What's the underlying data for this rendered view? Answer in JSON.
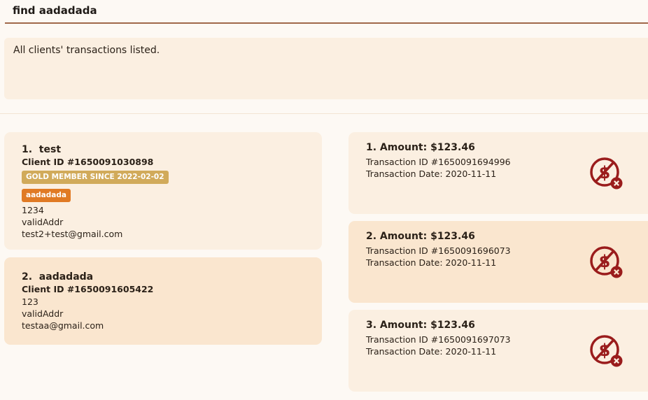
{
  "command": {
    "value": "find aadadada"
  },
  "result": {
    "text": "All clients' transactions listed."
  },
  "clients": [
    {
      "title": "1.  test",
      "client_id": "Client ID #1650091030898",
      "membership": "GOLD MEMBER SINCE 2022-02-02",
      "tag": "aadadada",
      "phone": "1234",
      "address": "validAddr",
      "email": "test2+test@gmail.com"
    },
    {
      "title": "2.  aadadada",
      "client_id": "Client ID #1650091605422",
      "phone": "123",
      "address": "validAddr",
      "email": "testaa@gmail.com"
    }
  ],
  "transactions": [
    {
      "title": "1. Amount: $123.46",
      "transaction_id": "Transaction ID #1650091694996",
      "date": "Transaction Date: 2020-11-11",
      "status_icon": "unpaid-dollar-icon"
    },
    {
      "title": "2. Amount: $123.46",
      "transaction_id": "Transaction ID #1650091696073",
      "date": "Transaction Date: 2020-11-11",
      "status_icon": "unpaid-dollar-icon"
    },
    {
      "title": "3. Amount: $123.46",
      "transaction_id": "Transaction ID #1650091697073",
      "date": "Transaction Date: 2020-11-11",
      "status_icon": "unpaid-dollar-icon"
    }
  ],
  "colors": {
    "icon": "#9a1c1c",
    "gold_badge": "#d1aa5a",
    "tag_badge": "#e07a24"
  }
}
